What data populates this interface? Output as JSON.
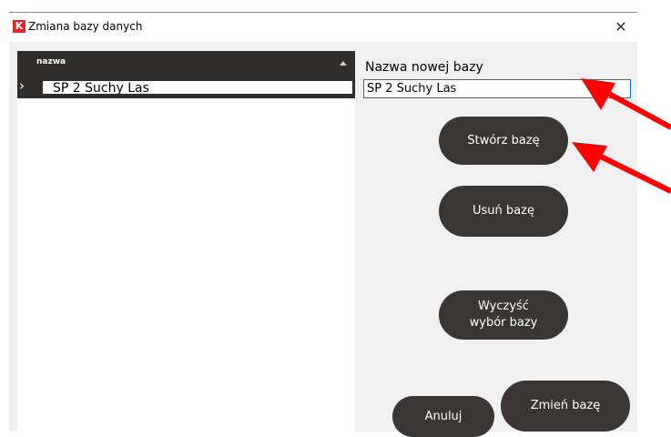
{
  "window": {
    "title": "Zmiana bazy danych",
    "icon_letter": "K",
    "close_glyph": "✕"
  },
  "list": {
    "column_header": "nazwa",
    "rows": [
      {
        "name": "SP 2 Suchy Las",
        "selected": true
      }
    ]
  },
  "form": {
    "label": "Nazwa nowej bazy",
    "value": "SP 2 Suchy Las"
  },
  "buttons": {
    "create": "Stwórz bazę",
    "delete": "Usuń bazę",
    "clear_line1": "Wyczyść",
    "clear_line2": "wybór bazy",
    "cancel": "Anuluj",
    "change": "Zmień bazę"
  },
  "colors": {
    "accent": "#0078d7",
    "button": "#3a3636",
    "header": "#2f2c2c",
    "annotation_arrow": "#ff0000"
  }
}
